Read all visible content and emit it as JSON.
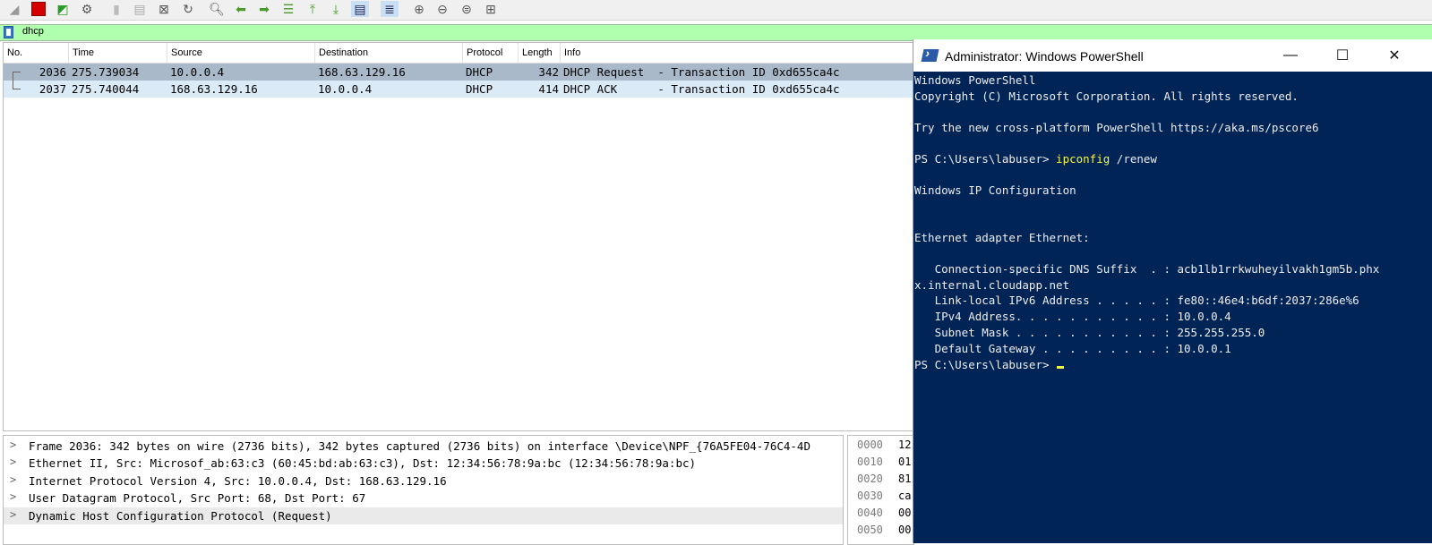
{
  "filter": {
    "text": "dhcp"
  },
  "columns": [
    "No.",
    "Time",
    "Source",
    "Destination",
    "Protocol",
    "Length",
    "Info"
  ],
  "packets": [
    {
      "no": "2036",
      "time": "275.739034",
      "source": "10.0.0.4",
      "destination": "168.63.129.16",
      "protocol": "DHCP",
      "length": "342",
      "info": "DHCP Request  - Transaction ID 0xd655ca4c"
    },
    {
      "no": "2037",
      "time": "275.740044",
      "source": "168.63.129.16",
      "destination": "10.0.0.4",
      "protocol": "DHCP",
      "length": "414",
      "info": "DHCP ACK      - Transaction ID 0xd655ca4c"
    }
  ],
  "details": [
    "Frame 2036: 342 bytes on wire (2736 bits), 342 bytes captured (2736 bits) on interface \\Device\\NPF_{76A5FE04-76C4-4D",
    "Ethernet II, Src: Microsof_ab:63:c3 (60:45:bd:ab:63:c3), Dst: 12:34:56:78:9a:bc (12:34:56:78:9a:bc)",
    "Internet Protocol Version 4, Src: 10.0.0.4, Dst: 168.63.129.16",
    "User Datagram Protocol, Src Port: 68, Dst Port: 67",
    "Dynamic Host Configuration Protocol (Request)"
  ],
  "hex": [
    {
      "offset": "0000",
      "bytes": "12"
    },
    {
      "offset": "0010",
      "bytes": "01"
    },
    {
      "offset": "0020",
      "bytes": "81"
    },
    {
      "offset": "0030",
      "bytes": "ca"
    },
    {
      "offset": "0040",
      "bytes": "00"
    },
    {
      "offset": "0050",
      "bytes": "00"
    }
  ],
  "powershell": {
    "title": "Administrator: Windows PowerShell",
    "lines": [
      "Windows PowerShell",
      "Copyright (C) Microsoft Corporation. All rights reserved.",
      "",
      "Try the new cross-platform PowerShell https://aka.ms/pscore6",
      "",
      "",
      "",
      "Windows IP Configuration",
      "",
      "",
      "Ethernet adapter Ethernet:",
      "",
      "   Connection-specific DNS Suffix  . : acb1lb1rrkwuheyilvakh1gm5b.phx",
      "x.internal.cloudapp.net",
      "   Link-local IPv6 Address . . . . . : fe80::46e4:b6df:2037:286e%6",
      "   IPv4 Address. . . . . . . . . . . : 10.0.0.4",
      "   Subnet Mask . . . . . . . . . . . : 255.255.255.0",
      "   Default Gateway . . . . . . . . . : 10.0.0.1"
    ],
    "prompt1": "PS C:\\Users\\labuser> ",
    "command": "ipconfig",
    "args": " /renew",
    "prompt2": "PS C:\\Users\\labuser> "
  }
}
